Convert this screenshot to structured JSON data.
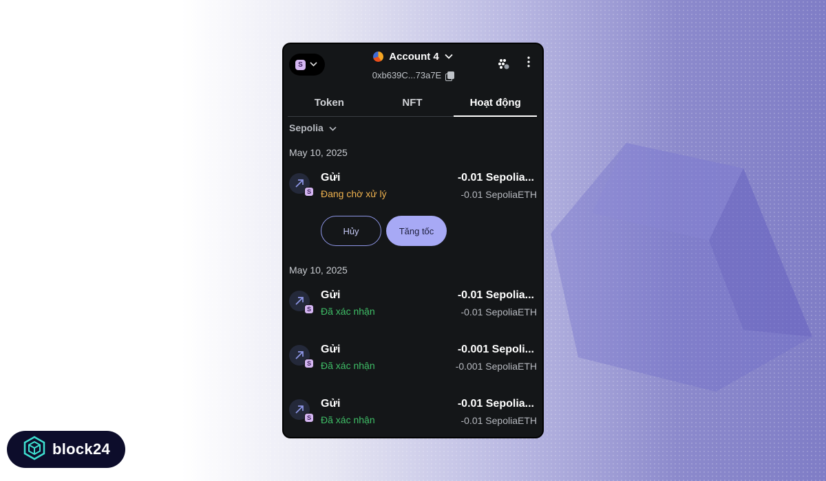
{
  "header": {
    "network_badge": "S",
    "account_name": "Account 4",
    "address": "0xb639C...73a7E"
  },
  "tabs": [
    {
      "label": "Token",
      "active": false
    },
    {
      "label": "NFT",
      "active": false
    },
    {
      "label": "Hoạt động",
      "active": true
    }
  ],
  "filter": {
    "network": "Sepolia"
  },
  "groups": [
    {
      "date": "May 10, 2025",
      "transactions": [
        {
          "title": "Gửi",
          "status": "Đang chờ xử lý",
          "status_type": "pending",
          "amount": "-0.01 Sepolia...",
          "amount_detail": "-0.01 SepoliaETH"
        }
      ],
      "actions": {
        "cancel": "Hủy",
        "speed_up": "Tăng tốc"
      }
    },
    {
      "date": "May 10, 2025",
      "transactions": [
        {
          "title": "Gửi",
          "status": "Đã xác nhận",
          "status_type": "confirmed",
          "amount": "-0.01 Sepolia...",
          "amount_detail": "-0.01 SepoliaETH"
        },
        {
          "title": "Gửi",
          "status": "Đã xác nhận",
          "status_type": "confirmed",
          "amount": "-0.001 Sepoli...",
          "amount_detail": "-0.001 SepoliaETH"
        },
        {
          "title": "Gửi",
          "status": "Đã xác nhận",
          "status_type": "confirmed",
          "amount": "-0.01 Sepolia...",
          "amount_detail": "-0.01 SepoliaETH"
        }
      ]
    }
  ],
  "logo": {
    "text": "block24"
  },
  "colors": {
    "panel_bg": "#141618",
    "pending": "#f0b34f",
    "confirmed": "#3fbf67",
    "accent": "#a7a9f5"
  }
}
